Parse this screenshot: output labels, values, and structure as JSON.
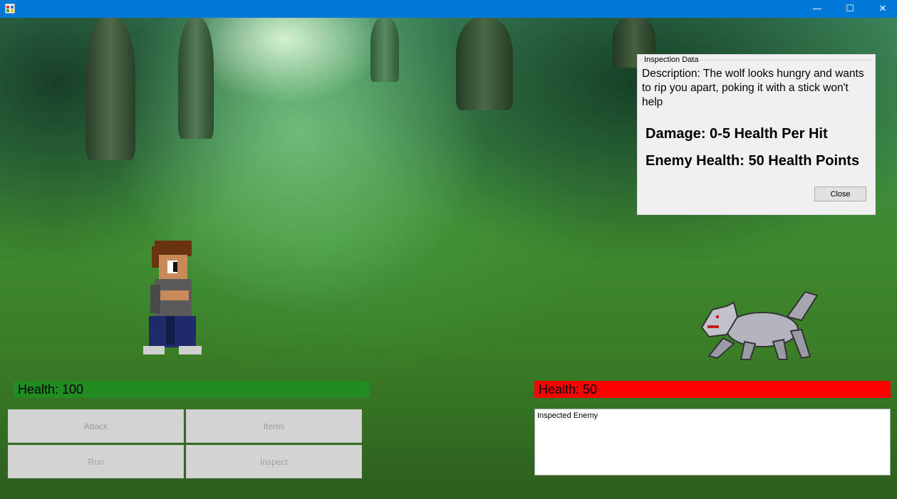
{
  "window": {
    "minimize_glyph": "—",
    "maximize_glyph": "☐",
    "close_glyph": "✕"
  },
  "player": {
    "health_text": "Health: 100"
  },
  "enemy": {
    "health_text": "Health: 50"
  },
  "actions": {
    "attack": "Attack",
    "items": "Items",
    "run": "Run",
    "inspect": "Inspect"
  },
  "log": {
    "text": "Inspected Enemy"
  },
  "inspection": {
    "title": "Inspection Data",
    "description": "Description: The wolf looks hungry and wants to rip you apart, poking it with a stick won't help",
    "damage": "Damage: 0-5 Health Per Hit",
    "enemy_health": "Enemy Health: 50 Health Points",
    "close_label": "Close"
  },
  "colors": {
    "titlebar": "#0078d7",
    "player_health_bar": "#228b22",
    "enemy_health_bar": "#ff0000"
  }
}
